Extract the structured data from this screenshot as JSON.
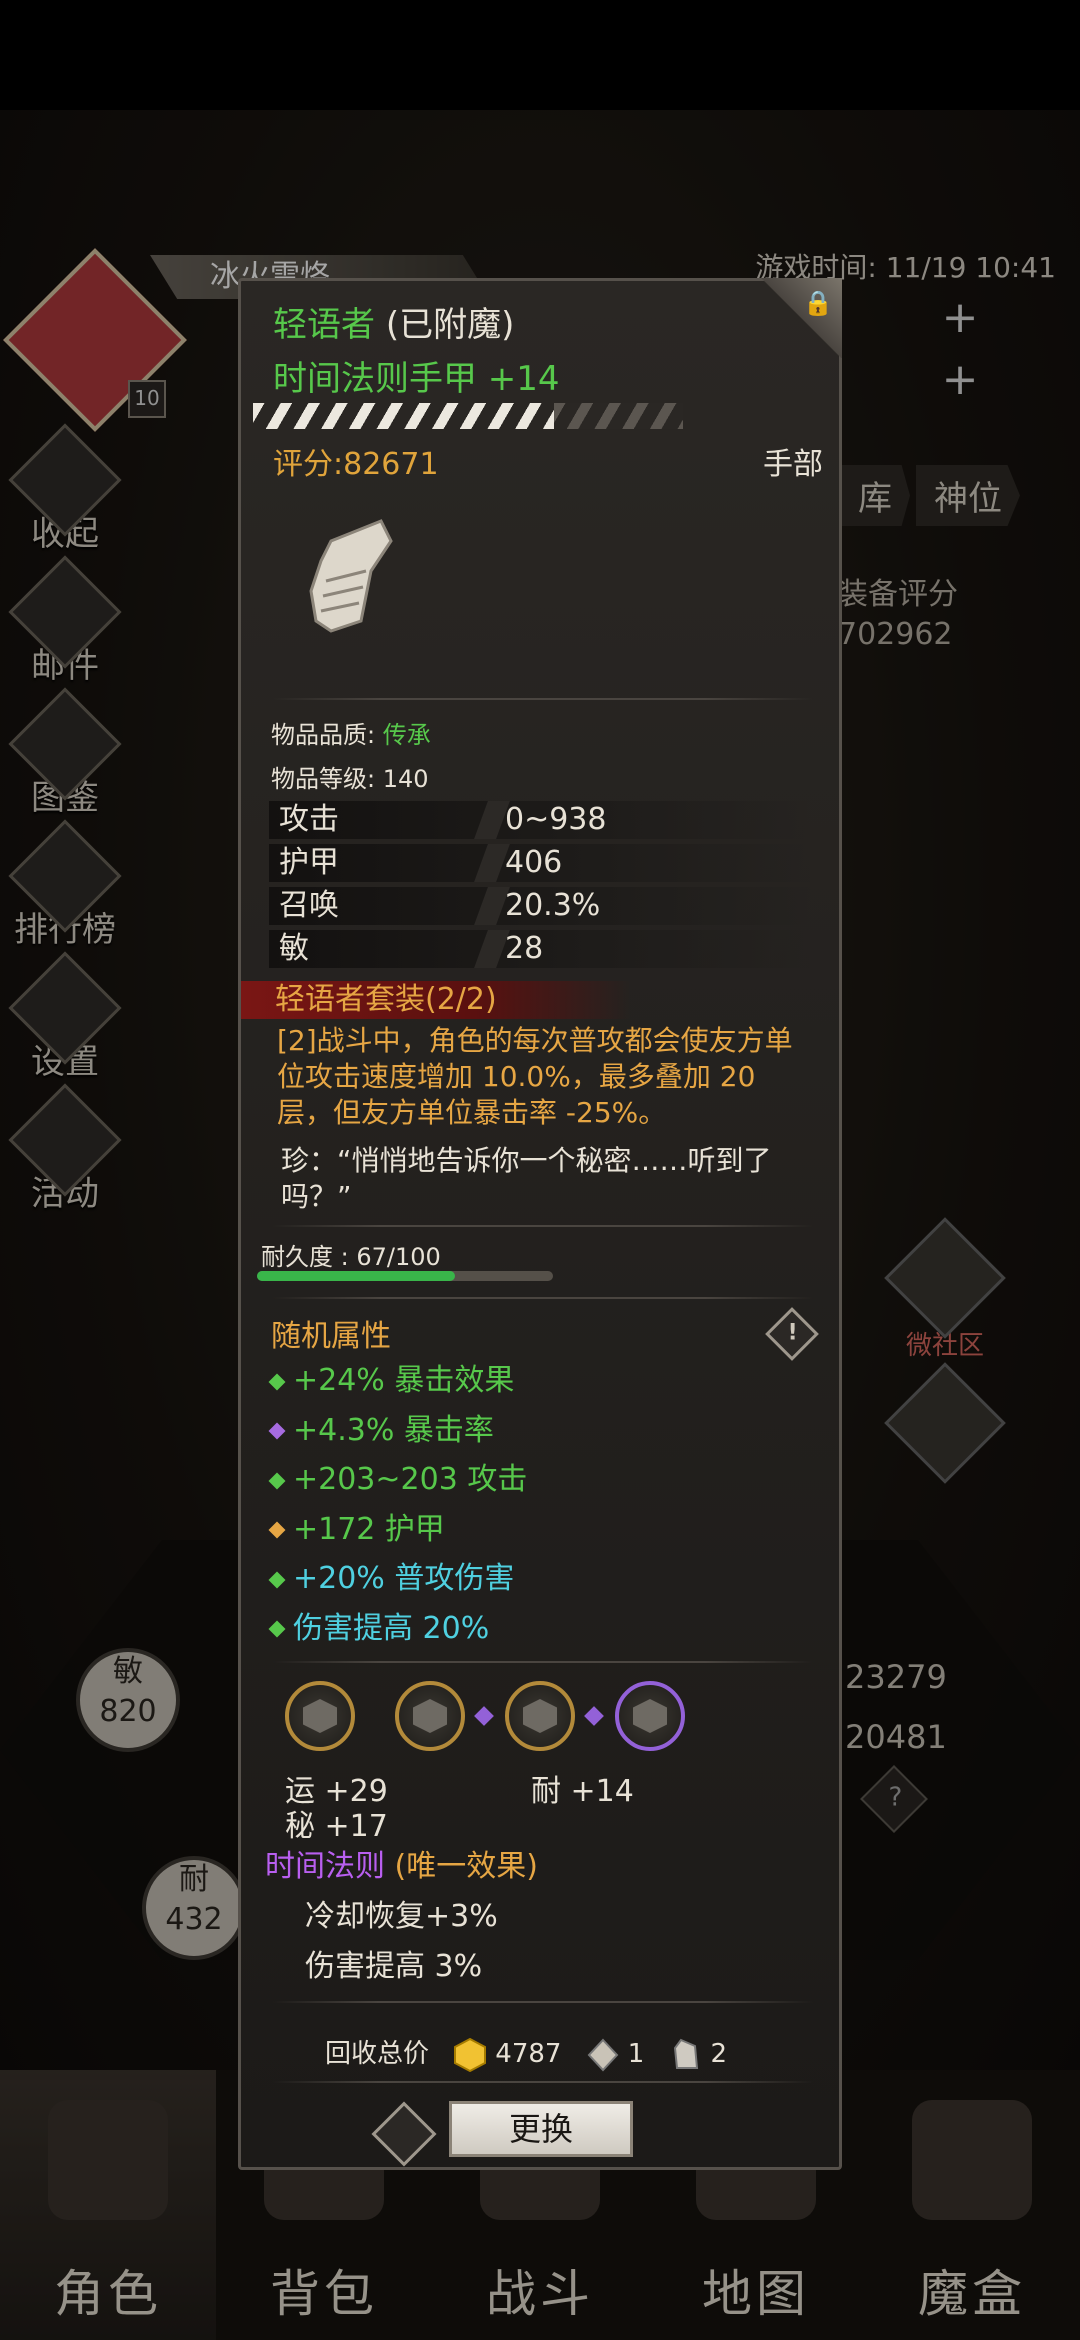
{
  "status": {
    "game_time": "游戏时间: 11/19 10:41"
  },
  "character": {
    "name": "冰火雷烙",
    "level": "10"
  },
  "side_menu": [
    {
      "label": "收起"
    },
    {
      "label": "邮件"
    },
    {
      "label": "图鉴"
    },
    {
      "label": "排行榜"
    },
    {
      "label": "设置"
    },
    {
      "label": "活动"
    }
  ],
  "right_tabs": [
    "库",
    "神位"
  ],
  "equip_score": {
    "label": "装备评分",
    "value": "702962"
  },
  "right_stats": [
    "23279",
    "20481"
  ],
  "stat_circles": [
    {
      "name": "敏",
      "value": "820"
    },
    {
      "name": "耐",
      "value": "432"
    }
  ],
  "community": {
    "label": "微社区"
  },
  "item": {
    "name": "轻语者",
    "enchant": "(已附魔)",
    "title": "时间法则手甲 +14",
    "score": "评分:82671",
    "slot": "手部",
    "stars_fraction": 0.7,
    "quality_label": "物品品质:",
    "quality_value": "传承",
    "level": "物品等级: 140",
    "stats": [
      {
        "k": "攻击",
        "v": "0~938"
      },
      {
        "k": "护甲",
        "v": "406"
      },
      {
        "k": "召唤",
        "v": "20.3%"
      },
      {
        "k": "敏",
        "v": "28"
      }
    ],
    "set_title": "轻语者套装(2/2)",
    "set_desc": "[2]战斗中，角色的每次普攻都会使友方单位攻击速度增加 10.0%，最多叠加 20 层，但友方单位暴击率 -25%。",
    "quote": "珍：“悄悄地告诉你一个秘密……听到了吗？”",
    "durability_label": "耐久度 : 67/100",
    "durability_fraction": 0.67,
    "random_title": "随机属性",
    "random_attrs": [
      {
        "text": "+24% 暴击效果",
        "color": "#57c84b",
        "bullet": "#57c84b"
      },
      {
        "text": "+4.3% 暴击率",
        "color": "#57c84b",
        "bullet": "#a66be0"
      },
      {
        "text": "+203~203 攻击",
        "color": "#57c84b",
        "bullet": "#57c84b"
      },
      {
        "text": "+172 护甲",
        "color": "#57c84b",
        "bullet": "#e6a644"
      },
      {
        "text": "+20% 普攻伤害",
        "color": "#4fd0e0",
        "bullet": "#57c84b"
      },
      {
        "text": "伤害提高 20%",
        "color": "#4fd0e0",
        "bullet": "#57c84b"
      }
    ],
    "gem_stats": [
      {
        "text": "运  +29"
      },
      {
        "text": "秘  +17"
      },
      {
        "text": "耐  +14"
      }
    ],
    "law_title": "时间法则",
    "law_tag": "(唯一效果)",
    "law_lines": [
      "冷却恢复+3%",
      "伤害提高 3%"
    ],
    "recycle_label": "回收总价",
    "recycle_values": [
      "4787",
      "1",
      "2"
    ],
    "swap_label": "更换"
  },
  "bottom_nav": [
    {
      "label": "角色"
    },
    {
      "label": "背包"
    },
    {
      "label": "战斗"
    },
    {
      "label": "地图"
    },
    {
      "label": "魔盒"
    }
  ]
}
